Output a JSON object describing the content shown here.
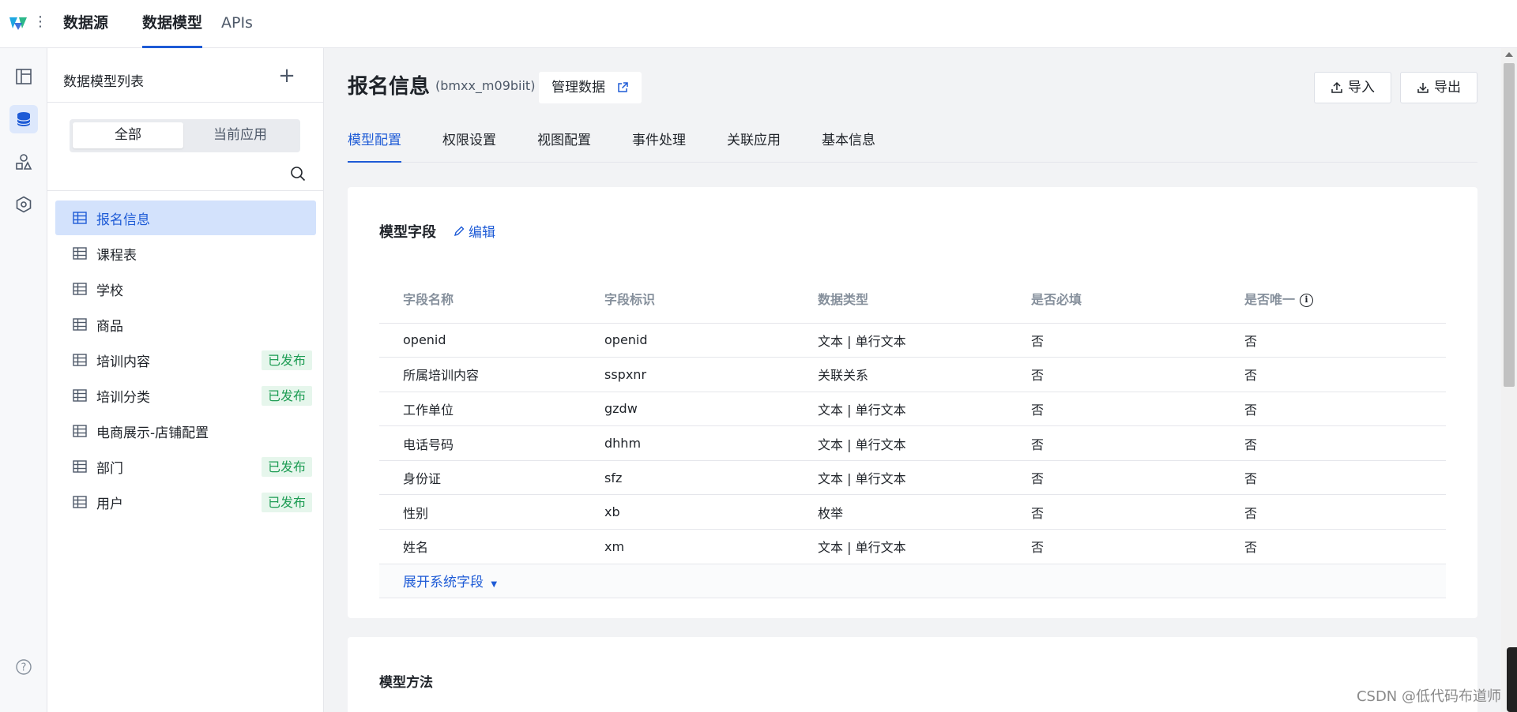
{
  "topbar": {
    "tabs": [
      {
        "label": "数据源"
      },
      {
        "label": "数据模型"
      },
      {
        "label": "APIs"
      }
    ]
  },
  "rail": {
    "icons": [
      "layout-icon",
      "database-icon",
      "shapes-icon",
      "hexagon-settings-icon",
      "help-icon"
    ]
  },
  "list_panel": {
    "title": "数据模型列表",
    "add_label": "+",
    "segments": [
      "全部",
      "当前应用"
    ],
    "items": [
      {
        "name": "报名信息",
        "badge": ""
      },
      {
        "name": "课程表",
        "badge": ""
      },
      {
        "name": "学校",
        "badge": ""
      },
      {
        "name": "商品",
        "badge": ""
      },
      {
        "name": "培训内容",
        "badge": "已发布"
      },
      {
        "name": "培训分类",
        "badge": "已发布"
      },
      {
        "name": "电商展示-店铺配置",
        "badge": ""
      },
      {
        "name": "部门",
        "badge": "已发布"
      },
      {
        "name": "用户",
        "badge": "已发布"
      }
    ]
  },
  "header": {
    "title": "报名信息",
    "id": "(bmxx_m09biit)",
    "manage_label": "管理数据",
    "import_label": "导入",
    "export_label": "导出"
  },
  "tabs": [
    "模型配置",
    "权限设置",
    "视图配置",
    "事件处理",
    "关联应用",
    "基本信息"
  ],
  "fields_card": {
    "title": "模型字段",
    "edit_label": "编辑",
    "columns": [
      "字段名称",
      "字段标识",
      "数据类型",
      "是否必填",
      "是否唯一"
    ],
    "rows": [
      [
        "openid",
        "openid",
        "文本 | 单行文本",
        "否",
        "否"
      ],
      [
        "所属培训内容",
        "sspxnr",
        "关联关系",
        "否",
        "否"
      ],
      [
        "工作单位",
        "gzdw",
        "文本 | 单行文本",
        "否",
        "否"
      ],
      [
        "电话号码",
        "dhhm",
        "文本 | 单行文本",
        "否",
        "否"
      ],
      [
        "身份证",
        "sfz",
        "文本 | 单行文本",
        "否",
        "否"
      ],
      [
        "性别",
        "xb",
        "枚举",
        "否",
        "否"
      ],
      [
        "姓名",
        "xm",
        "文本 | 单行文本",
        "否",
        "否"
      ]
    ],
    "expand_label": "展开系统字段"
  },
  "methods_card": {
    "title": "模型方法"
  },
  "watermark": "CSDN @低代码布道师",
  "colors": {
    "accent": "#1e5bd6",
    "active_bg": "#d3e2fc",
    "badge_text": "#1f9d55",
    "badge_bg": "#e6f6ec"
  }
}
